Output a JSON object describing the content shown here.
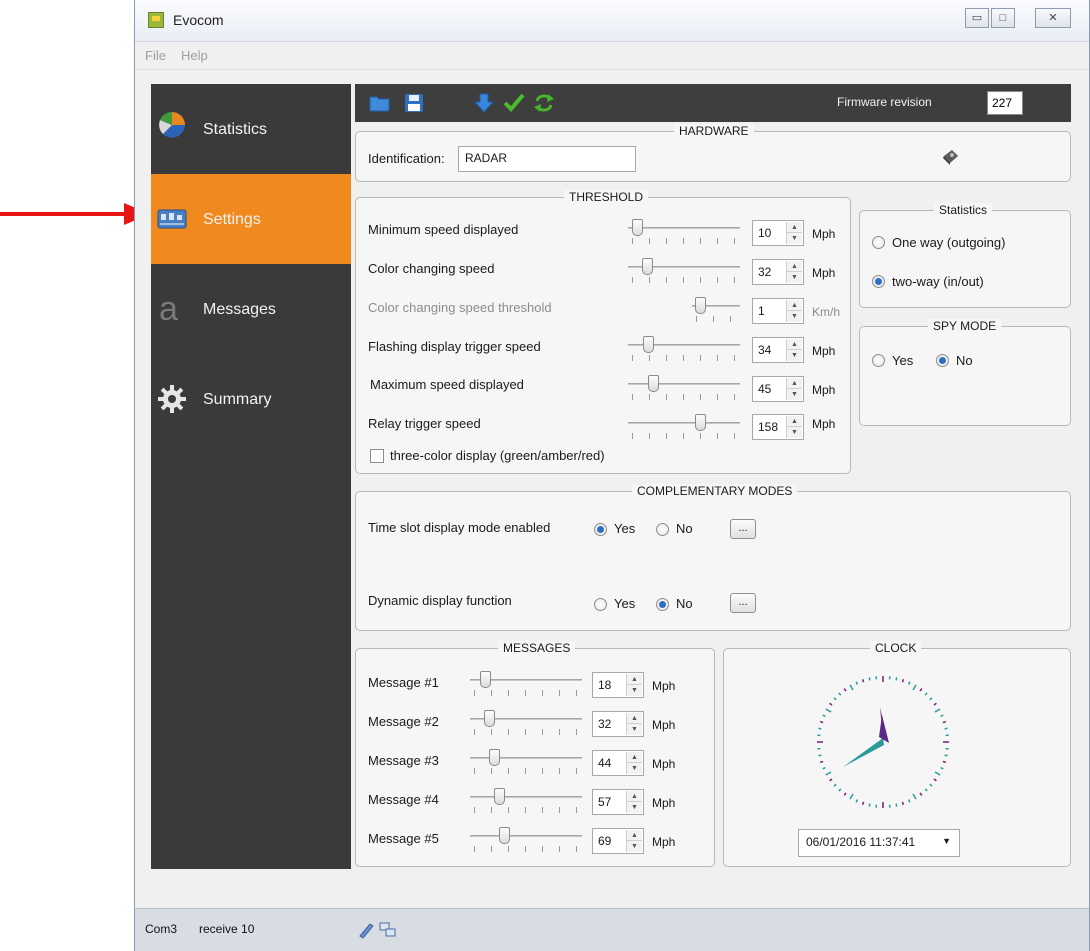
{
  "window": {
    "title": "Evocom"
  },
  "menu": {
    "file": "File",
    "help": "Help"
  },
  "sidebar": {
    "items": [
      {
        "label": "Statistics",
        "icon": "pie-chart-icon"
      },
      {
        "label": "Settings",
        "icon": "settings-panel-icon"
      },
      {
        "label": "Messages",
        "icon": "letter-a-icon"
      },
      {
        "label": "Summary",
        "icon": "gear-icon"
      }
    ],
    "active": "Settings"
  },
  "toolbar": {
    "icons": [
      "open-folder-icon",
      "save-icon",
      "download-icon",
      "checkmark-icon",
      "refresh-icon"
    ],
    "firmware_label": "Firmware revision",
    "firmware_value": "227"
  },
  "hardware": {
    "title": "HARDWARE",
    "identification_label": "Identification:",
    "identification_value": "RADAR"
  },
  "threshold": {
    "title": "THRESHOLD",
    "rows": [
      {
        "label": "Minimum speed displayed",
        "value": "10",
        "unit": "Mph",
        "level": 0.04
      },
      {
        "label": "Color changing speed",
        "value": "32",
        "unit": "Mph",
        "level": 0.14
      },
      {
        "label": "Color changing speed threshold",
        "value": "1",
        "unit": "Km/h",
        "level": 0.08
      },
      {
        "label": "Flashing display trigger speed",
        "value": "34",
        "unit": "Mph",
        "level": 0.15
      },
      {
        "label": "Maximum speed displayed",
        "value": "45",
        "unit": "Mph",
        "level": 0.2
      },
      {
        "label": "Relay trigger speed",
        "value": "158",
        "unit": "Mph",
        "level": 0.66
      }
    ],
    "three_color_label": "three-color display (green/amber/red)",
    "three_color_checked": false
  },
  "statistics_box": {
    "title": "Statistics",
    "option1": "One way (outgoing)",
    "option2": "two-way (in/out)",
    "selected": "two-way (in/out)"
  },
  "spy_mode": {
    "title": "SPY MODE",
    "yes": "Yes",
    "no": "No",
    "selected": "No"
  },
  "complementary": {
    "title": "COMPLEMENTARY MODES",
    "time_slot_label": "Time slot display mode enabled",
    "time_slot_yes": "Yes",
    "time_slot_no": "No",
    "time_slot_selected": "Yes",
    "dynamic_label": "Dynamic display function",
    "dynamic_yes": "Yes",
    "dynamic_no": "No",
    "dynamic_selected": "No",
    "more_button": "..."
  },
  "messages": {
    "title": "MESSAGES",
    "rows": [
      {
        "label": "Message #1",
        "value": "18",
        "unit": "Mph",
        "level": 0.1
      },
      {
        "label": "Message #2",
        "value": "32",
        "unit": "Mph",
        "level": 0.14
      },
      {
        "label": "Message #3",
        "value": "44",
        "unit": "Mph",
        "level": 0.19
      },
      {
        "label": "Message #4",
        "value": "57",
        "unit": "Mph",
        "level": 0.24
      },
      {
        "label": "Message #5",
        "value": "69",
        "unit": "Mph",
        "level": 0.29
      }
    ]
  },
  "clock": {
    "title": "CLOCK",
    "datetime": "06/01/2016 11:37:41"
  },
  "status": {
    "port": "Com3",
    "receive": "receive 10",
    "icons": [
      "connection-icon",
      "network-icon"
    ]
  },
  "colors": {
    "accent": "#f08a1e",
    "sidebar_bg": "#3a3a3a",
    "radio_selected": "#2d6fc2",
    "annotation_arrow": "#e81515",
    "clock_hand_purple": "#7a1a7a",
    "clock_hand_teal": "#2a9a9a"
  }
}
